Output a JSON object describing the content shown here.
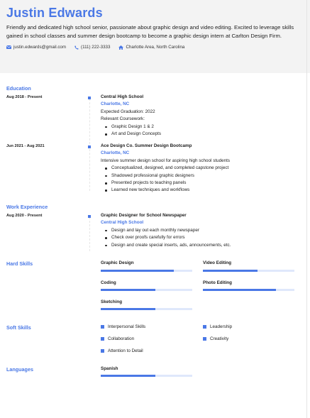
{
  "header": {
    "name": "Justin Edwards",
    "summary": "Friendly and dedicated high school senior, passionate about graphic design and video editing. Excited to leverage skills gained in school classes and summer design bootcamp to become a graphic design intern at Carlton Design Firm.",
    "email": "justin.edwards@gmail.com",
    "phone": "(111) 222-3333",
    "location": "Charlotte Area, North Carolina"
  },
  "sections": {
    "education": "Education",
    "work": "Work Experience",
    "hard_skills": "Hard Skills",
    "soft_skills": "Soft Skills",
    "languages": "Languages"
  },
  "education": [
    {
      "date": "Aug 2018 - Present",
      "title": "Central High School",
      "location": "Charlotte, NC",
      "lines": [
        "Expected Graduation: 2022",
        "Relevant Coursework:"
      ],
      "bullets": [
        "Graphic Design 1 & 2",
        "Art and Design Concepts"
      ]
    },
    {
      "date": "Jun 2021 - Aug 2021",
      "title": "Ace Design Co. Summer Design Bootcamp",
      "location": "Charlotte, NC",
      "lines": [
        "Intensive summer design school for aspiring high school students"
      ],
      "bullets": [
        "Conceptualized, designed, and completed capstone project",
        "Shadowed professional graphic designers",
        "Presented projects to teaching panels",
        "Learned new techniques and workflows"
      ]
    }
  ],
  "work": [
    {
      "date": "Aug 2020 - Present",
      "title": "Graphic Designer for School Newspaper",
      "location": "Central High School",
      "bullets": [
        "Design and lay out each monthly newspaper",
        "Check over proofs carefully for errors",
        "Design and create special inserts, ads, announcements, etc."
      ]
    }
  ],
  "hard_skills": [
    {
      "name": "Graphic Design",
      "level": 0.8
    },
    {
      "name": "Video Editing",
      "level": 0.6
    },
    {
      "name": "Coding",
      "level": 0.6
    },
    {
      "name": "Photo Editing",
      "level": 0.8
    },
    {
      "name": "Sketching",
      "level": 0.6
    }
  ],
  "soft_skills": [
    "Interpersonal Skills",
    "Leadership",
    "Collaboration",
    "Creativity",
    "Attention to Detail"
  ],
  "languages": [
    {
      "name": "Spanish",
      "level": 0.6
    }
  ],
  "colors": {
    "accent": "#4a78e6",
    "track": "#dfe8fb",
    "header_bg": "#f3f3f3"
  }
}
